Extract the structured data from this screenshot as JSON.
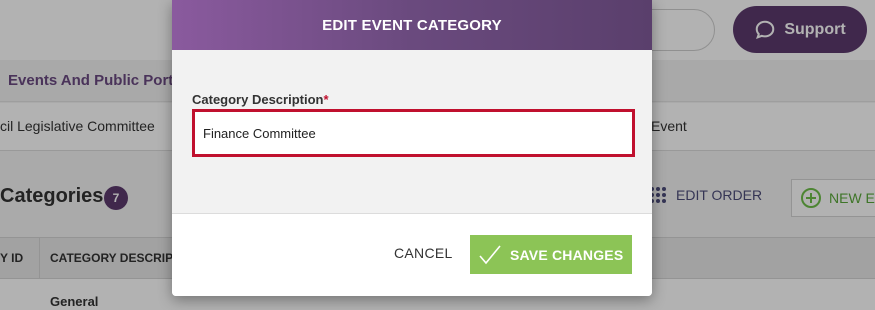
{
  "header": {
    "support_label": "Support"
  },
  "breadcrumb": {
    "label": "Events And Public Port"
  },
  "tabs": {
    "left_label": "cil Legislative Committee",
    "right_label": "Event"
  },
  "section": {
    "title": "Categories",
    "count": "7",
    "edit_order_label": "EDIT ORDER",
    "new_label": "NEW E"
  },
  "table": {
    "headers": [
      "Y ID",
      "CATEGORY DESCRIP"
    ],
    "rows": [
      {
        "description": "General"
      }
    ]
  },
  "modal": {
    "title": "EDIT EVENT CATEGORY",
    "field_label": "Category Description",
    "required_mark": "*",
    "field_value": "Finance Committee",
    "cancel_label": "CANCEL",
    "save_label": "SAVE CHANGES"
  },
  "colors": {
    "brand_purple": "#5c3a6e",
    "error_red": "#c0102e",
    "save_green": "#8cc456",
    "new_green": "#6fbf4a"
  },
  "icons": [
    "chat-bubble-icon",
    "drag-grid-icon",
    "plus-circle-icon",
    "checkmark-icon"
  ]
}
